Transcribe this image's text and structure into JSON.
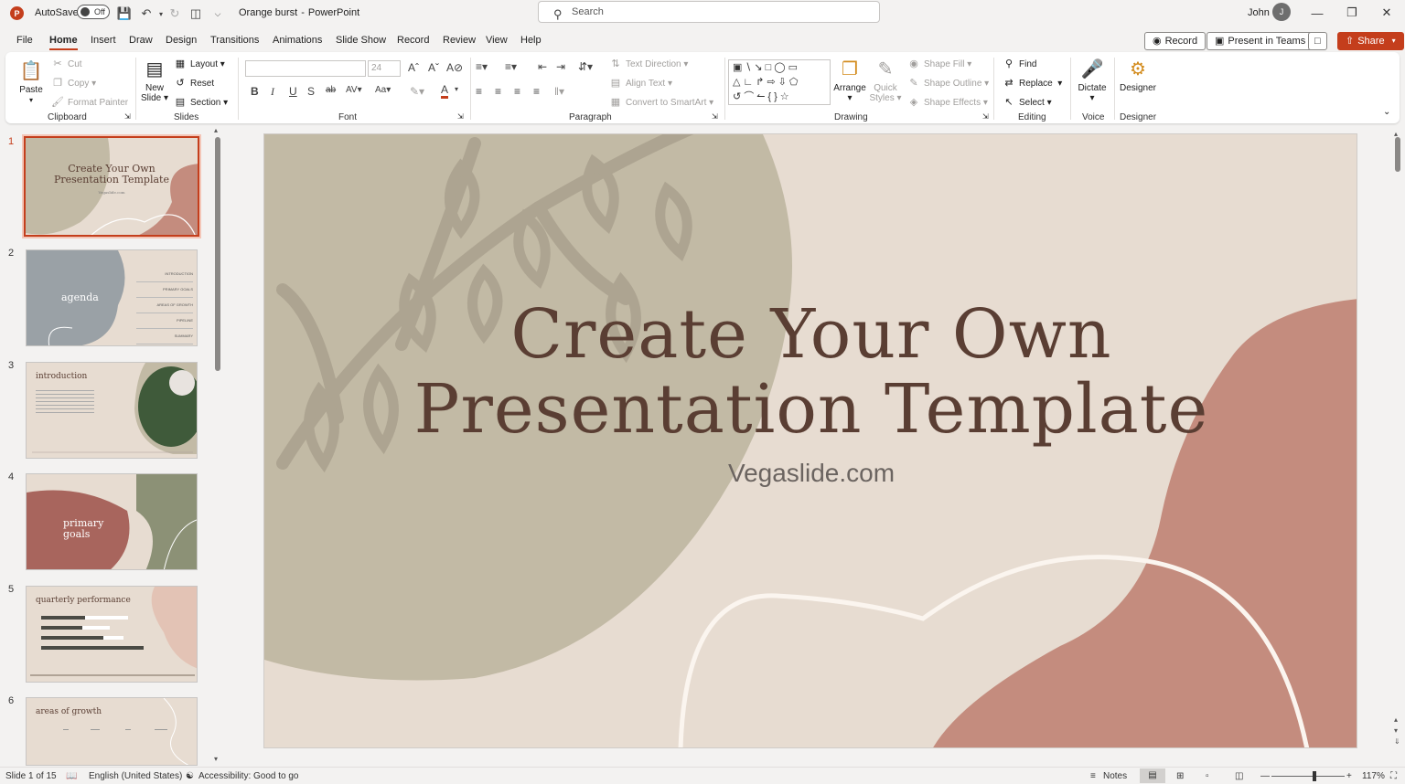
{
  "titlebar": {
    "autosave_label": "AutoSave",
    "autosave_state": "Off",
    "doc_title": "Orange burst",
    "app_name": "PowerPoint",
    "separator": "-",
    "search_placeholder": "Search",
    "user_name": "John",
    "user_initial": "J"
  },
  "menu": [
    "File",
    "Home",
    "Insert",
    "Draw",
    "Design",
    "Transitions",
    "Animations",
    "Slide Show",
    "Record",
    "Review",
    "View",
    "Help"
  ],
  "menu_active": "Home",
  "actions": {
    "record": "Record",
    "present_teams": "Present in Teams",
    "share": "Share"
  },
  "ribbon": {
    "clipboard": {
      "label": "Clipboard",
      "paste": "Paste",
      "cut": "Cut",
      "copy": "Copy",
      "format_painter": "Format Painter"
    },
    "slides": {
      "label": "Slides",
      "new_slide_1": "New",
      "new_slide_2": "Slide",
      "layout": "Layout",
      "reset": "Reset",
      "section": "Section"
    },
    "font": {
      "label": "Font",
      "size": "24"
    },
    "paragraph": {
      "label": "Paragraph",
      "text_direction": "Text Direction",
      "align_text": "Align Text",
      "convert_smartart": "Convert to SmartArt"
    },
    "drawing": {
      "label": "Drawing",
      "arrange": "Arrange",
      "quick_styles_1": "Quick",
      "quick_styles_2": "Styles",
      "shape_fill": "Shape Fill",
      "shape_outline": "Shape Outline",
      "shape_effects": "Shape Effects"
    },
    "editing": {
      "label": "Editing",
      "find": "Find",
      "replace": "Replace",
      "select": "Select"
    },
    "voice": {
      "label": "Voice",
      "dictate": "Dictate"
    },
    "designer": {
      "label": "Designer",
      "designer": "Designer"
    }
  },
  "thumbnails": [
    {
      "num": "1",
      "line1": "Create Your Own",
      "line2": "Presentation Template",
      "sub": "Vegaslide.com"
    },
    {
      "num": "2",
      "title": "agenda",
      "items": [
        "INTRODUCTION",
        "PRIMARY GOALS",
        "AREAS OF GROWTH",
        "PIPELINE",
        "SUMMARY"
      ]
    },
    {
      "num": "3",
      "title": "introduction"
    },
    {
      "num": "4",
      "line1": "primary",
      "line2": "goals"
    },
    {
      "num": "5",
      "title": "quarterly performance"
    },
    {
      "num": "6",
      "title": "areas of growth"
    }
  ],
  "slide": {
    "title_line1": "Create Your Own",
    "title_line2": "Presentation Template",
    "subtitle": "Vegaslide.com"
  },
  "status": {
    "slide_info": "Slide 1 of 15",
    "language": "English (United States)",
    "accessibility": "Accessibility: Good to go",
    "notes": "Notes",
    "zoom": "117%",
    "zoom_level": 0.59
  },
  "colors": {
    "accent": "#c43e1c",
    "slide_bg": "#e7dcd1",
    "sage": "#c2baa5",
    "terracotta": "#c48c7e",
    "title_text": "#5a3e33"
  }
}
